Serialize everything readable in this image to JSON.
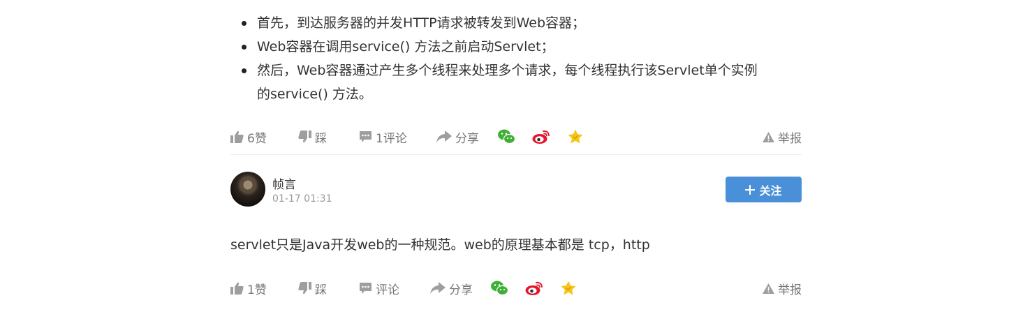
{
  "answer1": {
    "bullets": [
      {
        "text": "首先，到达服务器的并发HTTP请求被转发到Web容器；"
      },
      {
        "text": "Web容器在调用service() 方法之前启动Servlet；"
      },
      {
        "line1": "然后，Web容器通过产生多个线程来处理多个请求，每个线程执行该Servlet单个实例",
        "line2": "的service() 方法。"
      }
    ],
    "actions": {
      "like": "6赞",
      "dislike": "踩",
      "comment": "1评论",
      "share": "分享",
      "report": "举报"
    }
  },
  "answer2": {
    "author": {
      "name": "帧言",
      "time": "01-17 01:31",
      "follow_label": "关注"
    },
    "text": "servlet只是Java开发web的一种规范。web的原理基本都是 tcp，http",
    "actions": {
      "like": "1赞",
      "dislike": "踩",
      "comment": "评论",
      "share": "分享",
      "report": "举报"
    }
  },
  "colors": {
    "accent": "#4a90d9",
    "icon_gray": "#9e9e9e",
    "wechat": "#3eb135",
    "weibo": "#e6162d",
    "star": "#f5c518"
  },
  "icons": [
    "thumbs-up-icon",
    "thumbs-down-icon",
    "comment-icon",
    "share-icon",
    "wechat-icon",
    "weibo-icon",
    "star-icon",
    "warning-icon",
    "plus-icon"
  ]
}
